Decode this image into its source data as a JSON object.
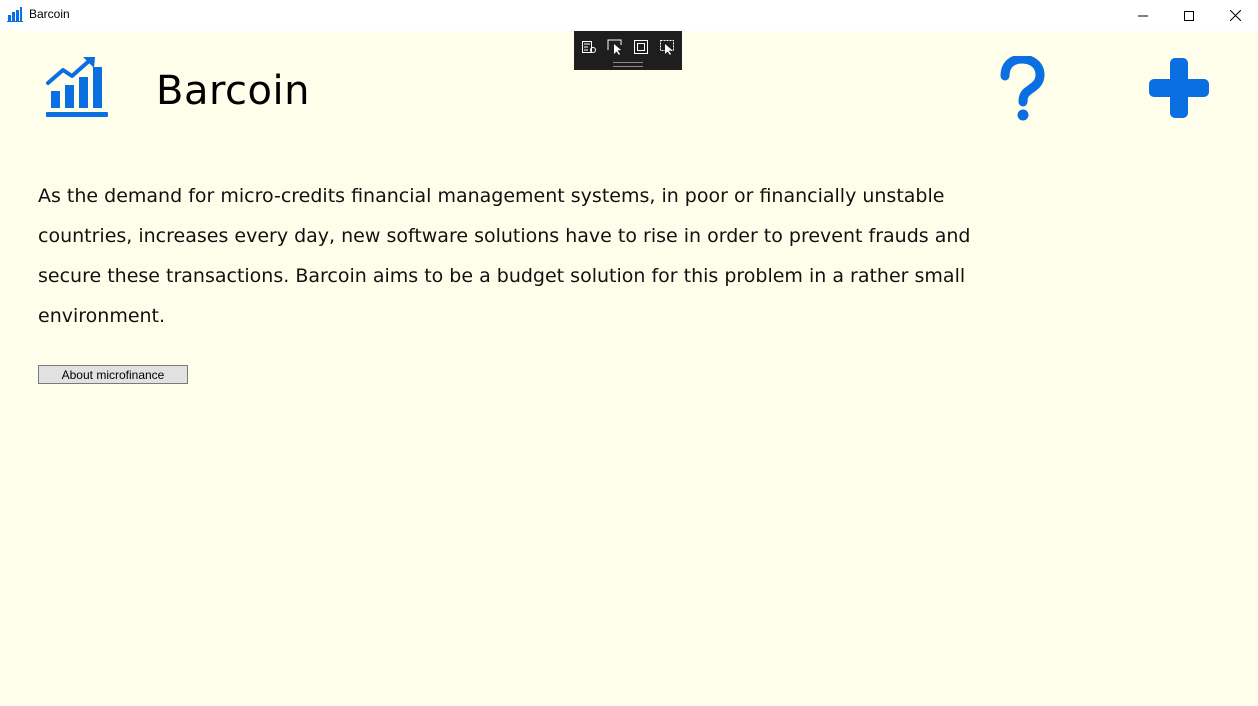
{
  "window": {
    "title": "Barcoin",
    "controls": [
      "minimize-icon",
      "maximize-icon",
      "close-icon"
    ]
  },
  "debug_toolbar": {
    "buttons": [
      "live-visual-tree-icon",
      "select-element-icon",
      "display-layout-adorners-icon",
      "track-focused-element-icon"
    ]
  },
  "header": {
    "title": "Barcoin",
    "logo_icon": "bar-chart-trend-icon",
    "help_icon": "question-mark-icon",
    "add_icon": "plus-icon"
  },
  "main": {
    "description": "As the demand for micro-credits financial management systems, in poor or financially unstable countries, increases every day, new software solutions have to rise in order to prevent frauds and secure these transactions. Barcoin aims to be a budget solution for this problem in a rather small environment.",
    "about_button_label": "About microfinance"
  },
  "colors": {
    "accent": "#0a6fe0",
    "background": "#fffeea",
    "titlebar": "#ffffff",
    "debug_toolbar": "#1e1e1e"
  }
}
